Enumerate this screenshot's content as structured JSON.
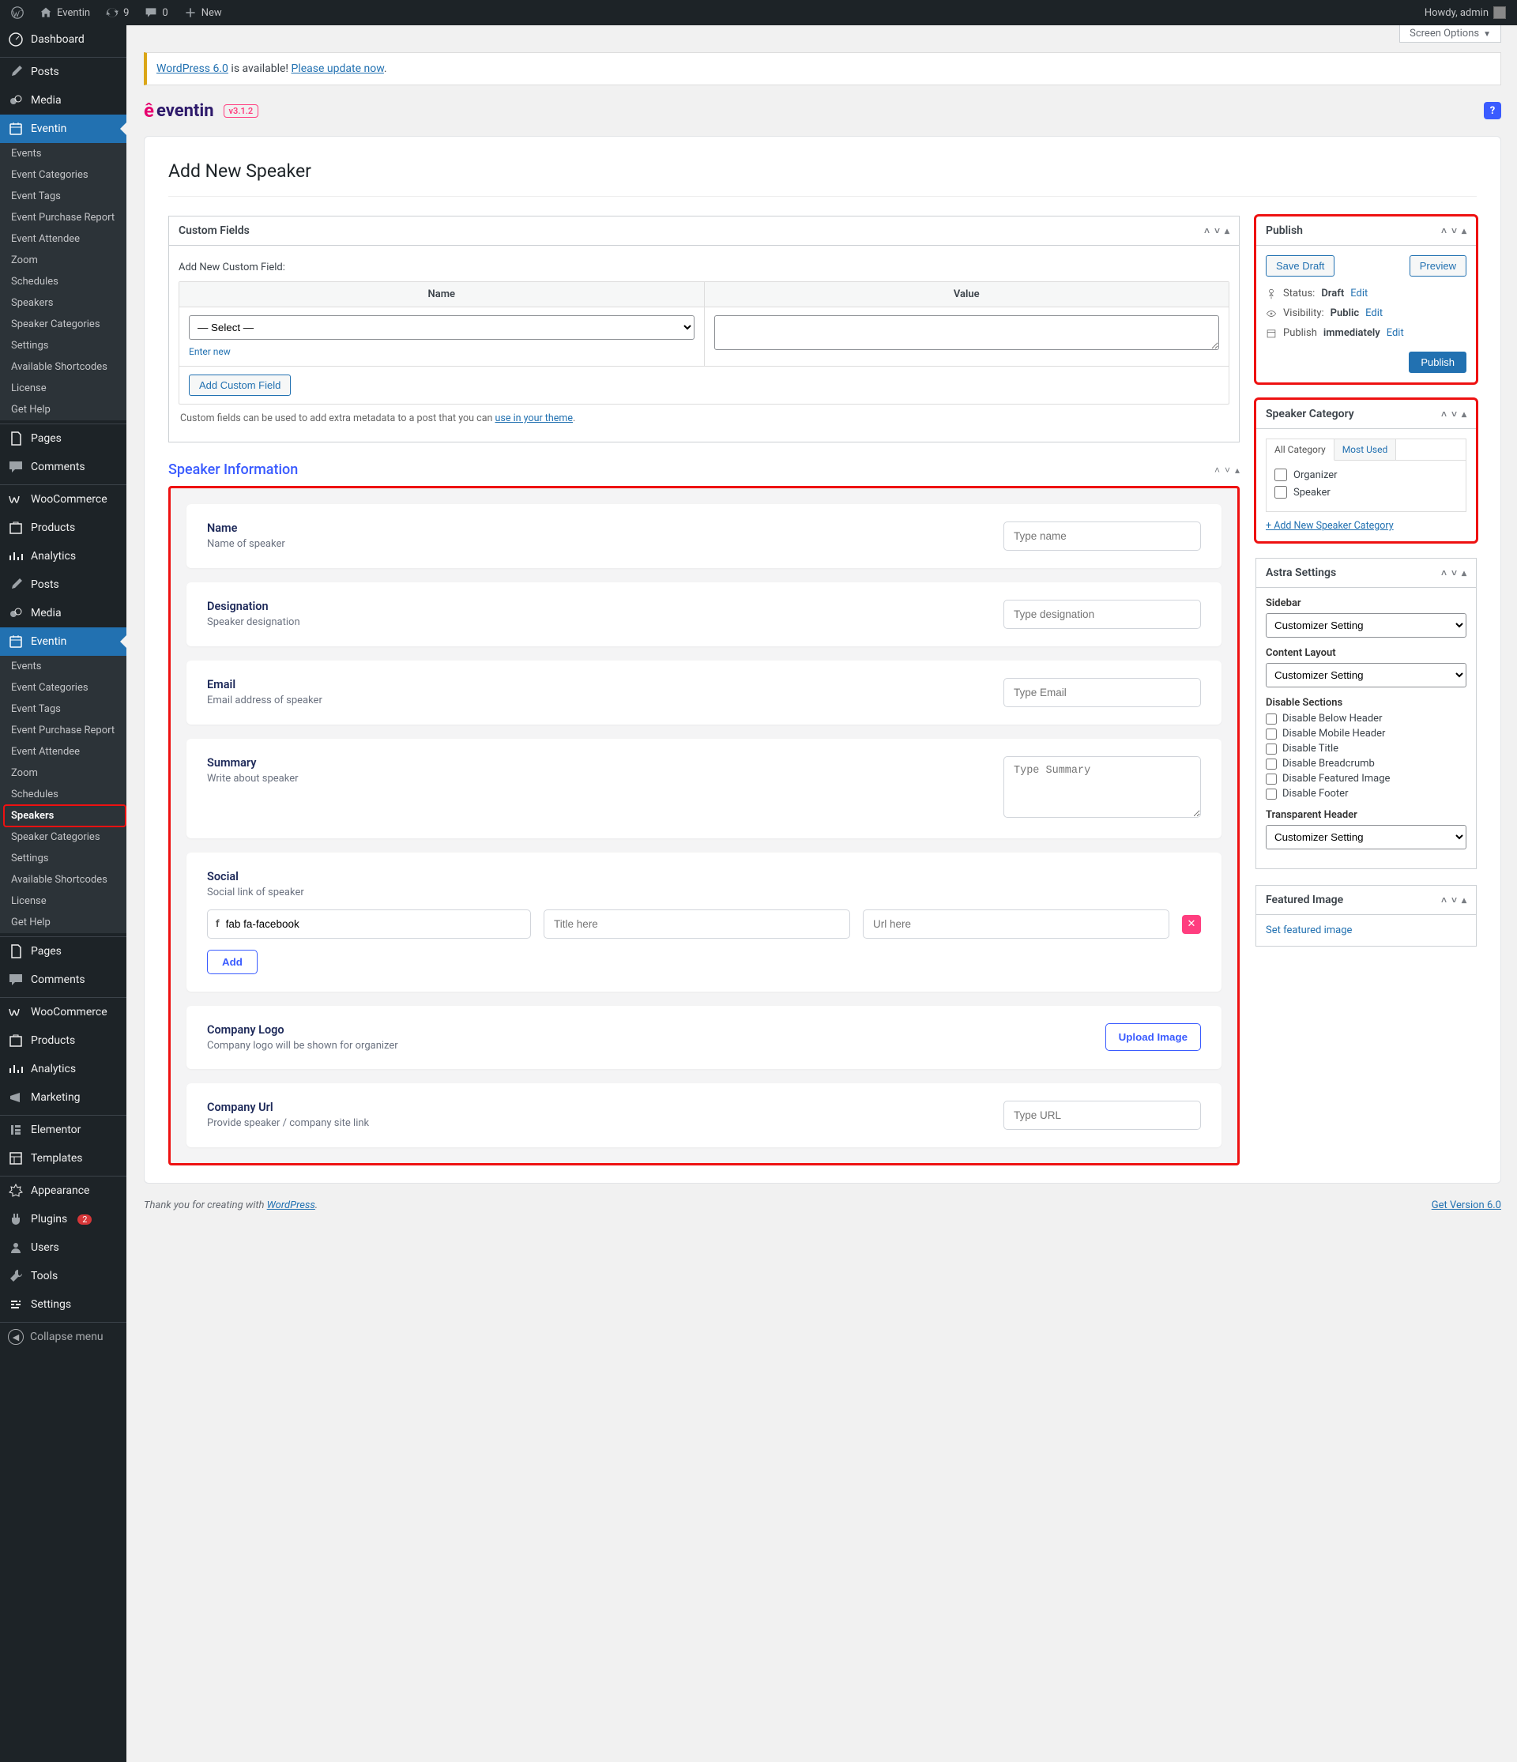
{
  "adminbar": {
    "site": "Eventin",
    "updates": "9",
    "comments": "0",
    "new": "New",
    "howdy": "Howdy, admin"
  },
  "screen_options": "Screen Options",
  "menu": {
    "dashboard": "Dashboard",
    "posts": "Posts",
    "media": "Media",
    "eventin": "Eventin",
    "pages": "Pages",
    "comments": "Comments",
    "woocommerce": "WooCommerce",
    "products": "Products",
    "analytics": "Analytics",
    "posts2": "Posts",
    "media2": "Media",
    "eventin2": "Eventin",
    "pages2": "Pages",
    "comments2": "Comments",
    "woocommerce2": "WooCommerce",
    "products2": "Products",
    "analytics2": "Analytics",
    "marketing": "Marketing",
    "elementor": "Elementor",
    "templates": "Templates",
    "appearance": "Appearance",
    "plugins": "Plugins",
    "plugins_badge": "2",
    "users": "Users",
    "tools": "Tools",
    "settings": "Settings",
    "collapse": "Collapse menu"
  },
  "submenu": {
    "events": "Events",
    "categories": "Event Categories",
    "tags": "Event Tags",
    "purchase": "Event Purchase Report",
    "attendee": "Event Attendee",
    "zoom": "Zoom",
    "schedules": "Schedules",
    "speakers": "Speakers",
    "speaker_cats": "Speaker Categories",
    "settings": "Settings",
    "shortcodes": "Available Shortcodes",
    "license": "License",
    "help": "Get Help"
  },
  "update_nag": {
    "a": "WordPress 6.0",
    "b": " is available! ",
    "c": "Please update now"
  },
  "brand": {
    "name": "eventin",
    "version": "v3.1.2"
  },
  "page_title": "Add New Speaker",
  "cf": {
    "box_title": "Custom Fields",
    "add_title": "Add New Custom Field:",
    "name": "Name",
    "value": "Value",
    "select": "— Select —",
    "enter_new": "Enter new",
    "add_btn": "Add Custom Field",
    "note_a": "Custom fields can be used to add extra metadata to a post that you can ",
    "note_b": "use in your theme"
  },
  "speaker": {
    "section": "Speaker Information",
    "name": {
      "lbl": "Name",
      "desc": "Name of speaker",
      "ph": "Type name"
    },
    "designation": {
      "lbl": "Designation",
      "desc": "Speaker designation",
      "ph": "Type designation"
    },
    "email": {
      "lbl": "Email",
      "desc": "Email address of speaker",
      "ph": "Type Email"
    },
    "summary": {
      "lbl": "Summary",
      "desc": "Write about speaker",
      "ph": "Type Summary"
    },
    "social": {
      "lbl": "Social",
      "desc": "Social link of speaker",
      "icon_val": "fab fa-facebook",
      "title_ph": "Title here",
      "url_ph": "Url here",
      "add": "Add"
    },
    "logo": {
      "lbl": "Company Logo",
      "desc": "Company logo will be shown for organizer",
      "btn": "Upload Image"
    },
    "url": {
      "lbl": "Company Url",
      "desc": "Provide speaker / company site link",
      "ph": "Type URL"
    }
  },
  "publish": {
    "title": "Publish",
    "save": "Save Draft",
    "preview": "Preview",
    "status_lbl": "Status:",
    "status_val": "Draft",
    "vis_lbl": "Visibility:",
    "vis_val": "Public",
    "pub_lbl": "Publish",
    "pub_val": "immediately",
    "edit": "Edit",
    "submit": "Publish"
  },
  "cat": {
    "title": "Speaker Category",
    "tab_all": "All Category",
    "tab_most": "Most Used",
    "organizer": "Organizer",
    "speaker": "Speaker",
    "add": "+ Add New Speaker Category"
  },
  "astra": {
    "title": "Astra Settings",
    "sidebar": "Sidebar",
    "content": "Content Layout",
    "disable": "Disable Sections",
    "transparent": "Transparent Header",
    "customizer": "Customizer Setting",
    "d1": "Disable Below Header",
    "d2": "Disable Mobile Header",
    "d3": "Disable Title",
    "d4": "Disable Breadcrumb",
    "d5": "Disable Featured Image",
    "d6": "Disable Footer"
  },
  "featured": {
    "title": "Featured Image",
    "set": "Set featured image"
  },
  "footer": {
    "thank": "Thank you for creating with ",
    "wp": "WordPress",
    "ver": "Get Version 6.0"
  }
}
